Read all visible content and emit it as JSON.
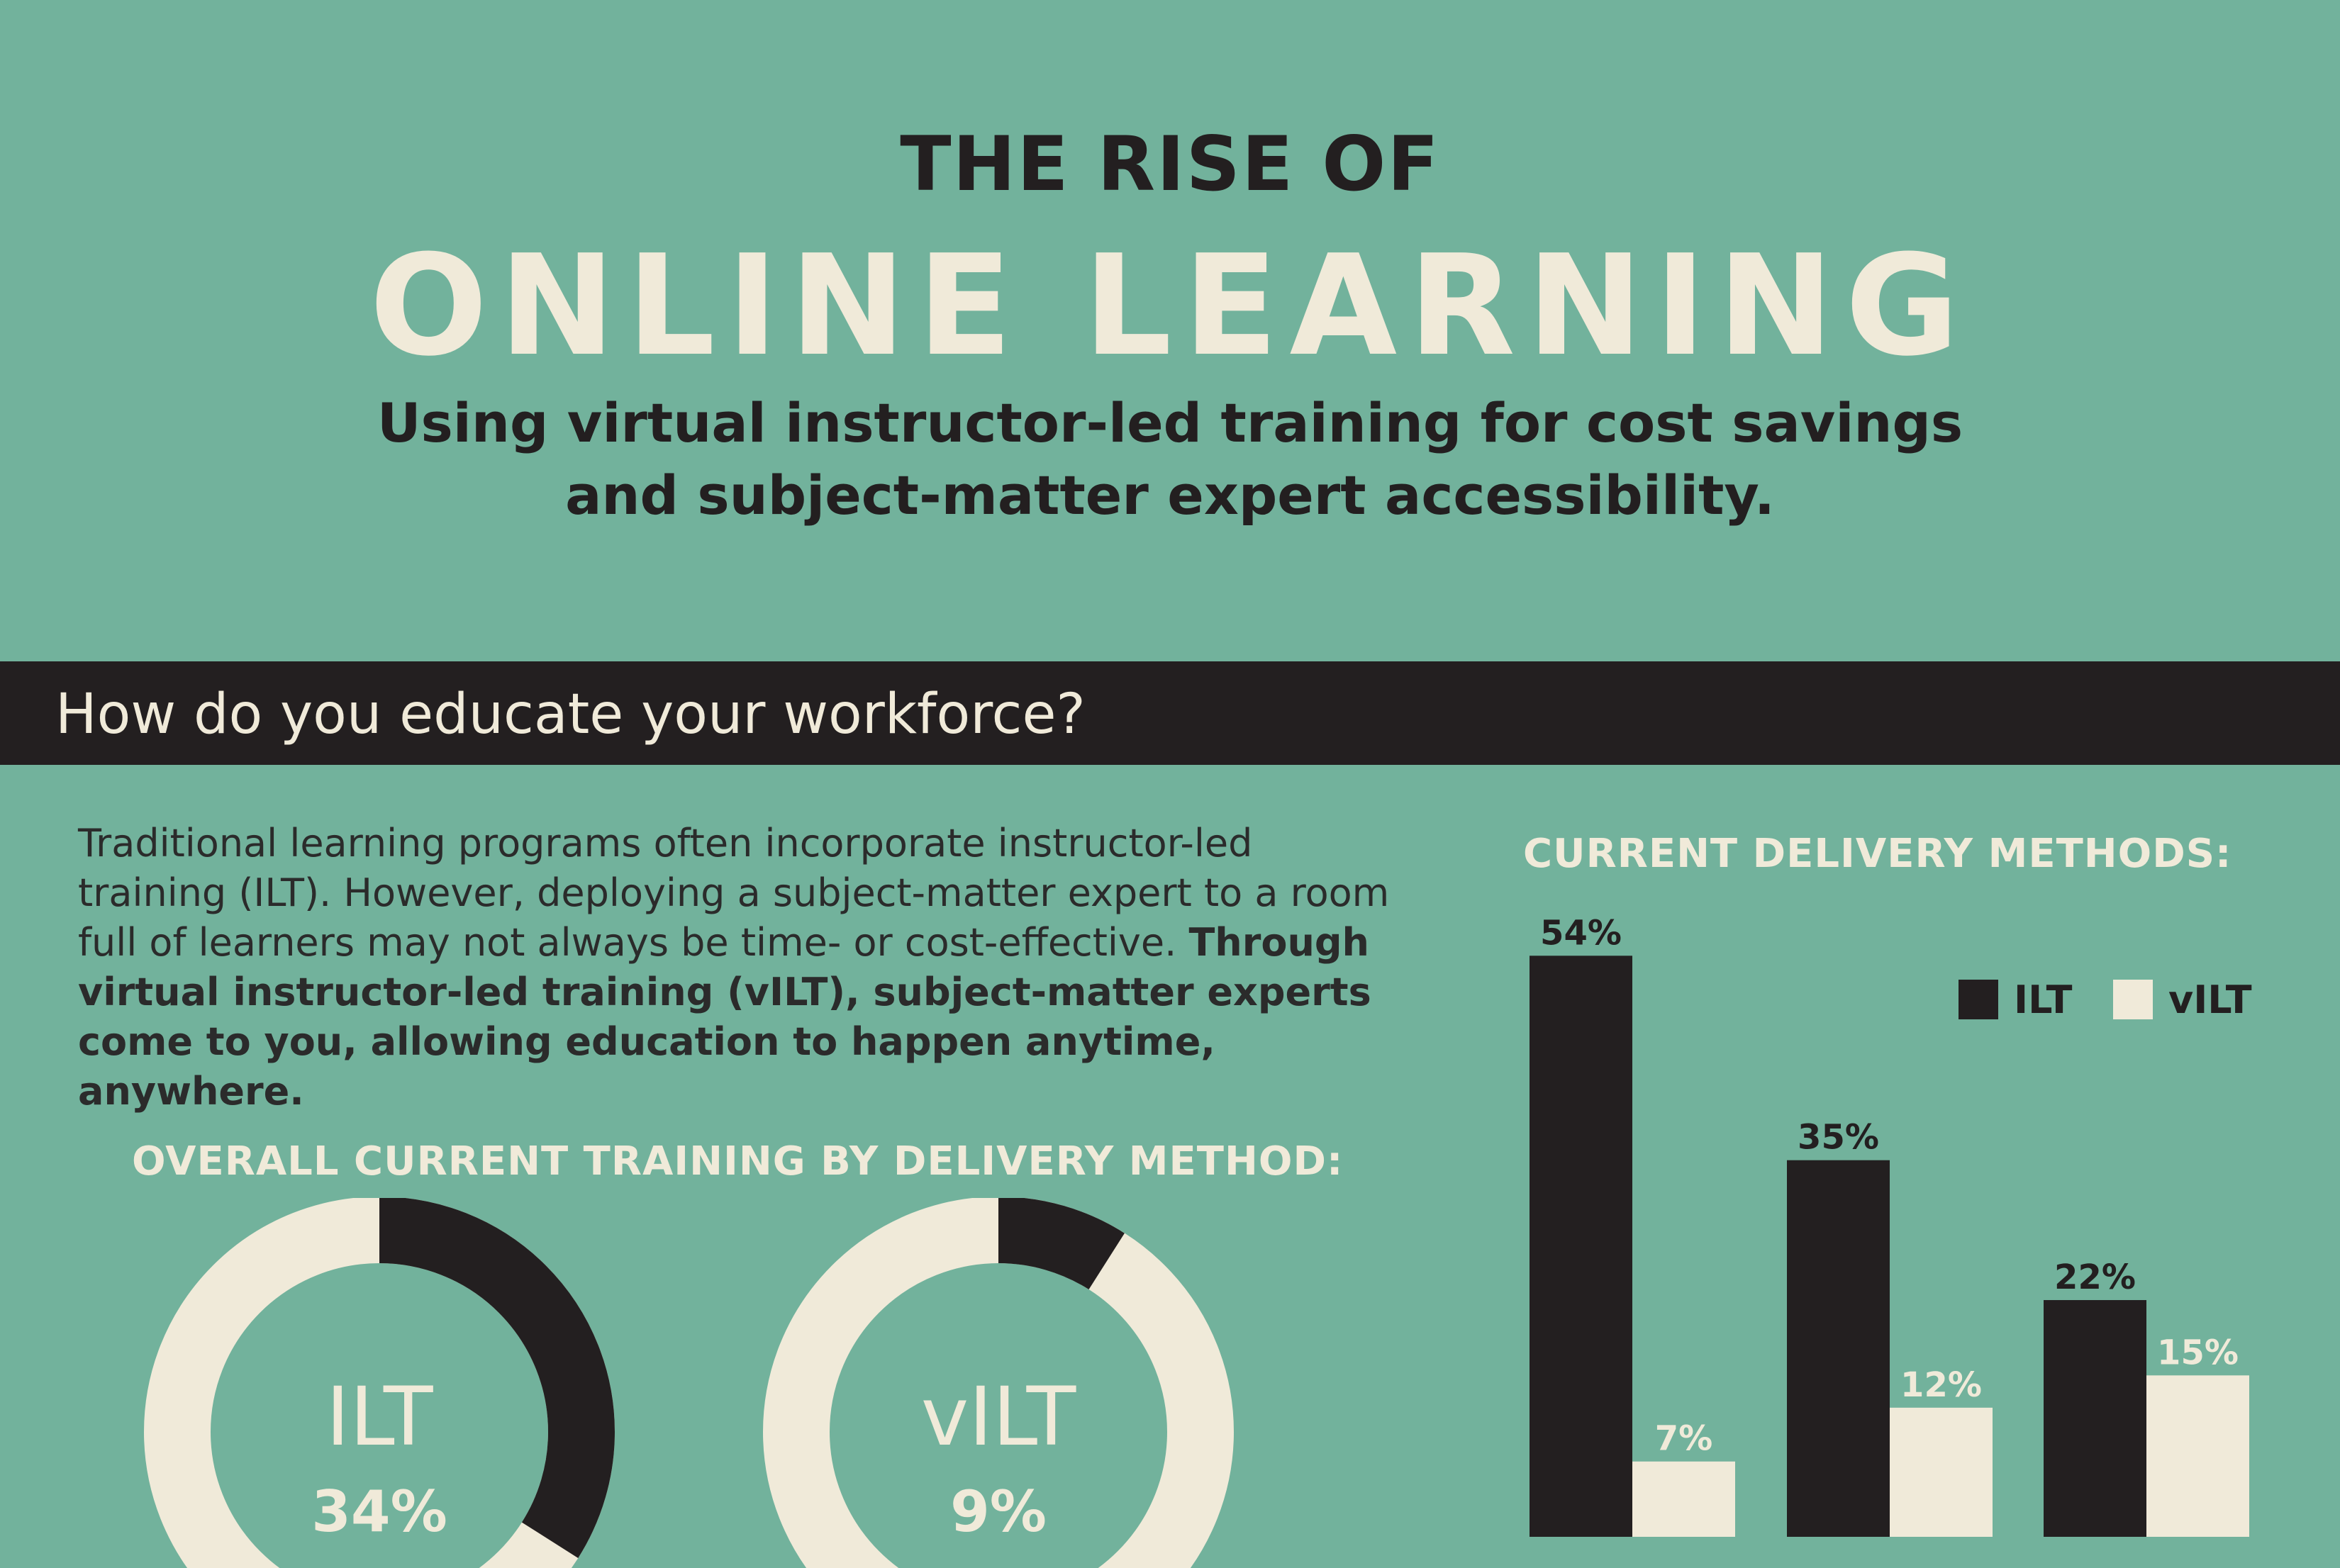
{
  "header": {
    "title_pre": "THE RISE OF",
    "title_main": "ONLINE LEARNING",
    "subtitle_line1": "Using virtual instructor-led training for cost savings",
    "subtitle_line2": "and subject-matter expert accessibility."
  },
  "section": {
    "title": "How do you educate your workforce?"
  },
  "intro": {
    "normal": "Traditional learning programs often incorporate instructor-led training (ILT). However, deploying a subject-matter expert to a room full of learners may not always be time- or cost-effective.",
    "bold": "Through virtual instructor-led training (vILT), subject-matter experts come to you, allowing education to happen anytime, anywhere."
  },
  "colors": {
    "background": "#72b29c",
    "dark": "#231f20",
    "cream": "#f0ead9"
  },
  "chart_data": [
    {
      "type": "pie",
      "title": "OVERALL CURRENT TRAINING BY DELIVERY METHOD:",
      "donuts": [
        {
          "label": "ILT",
          "value_label": "34%",
          "value": 34
        },
        {
          "label": "vILT",
          "value_label": "9%",
          "value": 9
        }
      ]
    },
    {
      "type": "bar",
      "title": "CURRENT DELIVERY METHODS:",
      "legend_position": "top-right",
      "categories": [
        "",
        "",
        ""
      ],
      "series": [
        {
          "name": "ILT",
          "values": [
            54,
            35,
            22
          ],
          "labels": [
            "54%",
            "35%",
            "22%"
          ],
          "color": "#231f20"
        },
        {
          "name": "vILT",
          "values": [
            7,
            12,
            15
          ],
          "labels": [
            "7%",
            "12%",
            "15%"
          ],
          "color": "#f0ead9"
        }
      ],
      "ylim": [
        0,
        60
      ]
    }
  ]
}
